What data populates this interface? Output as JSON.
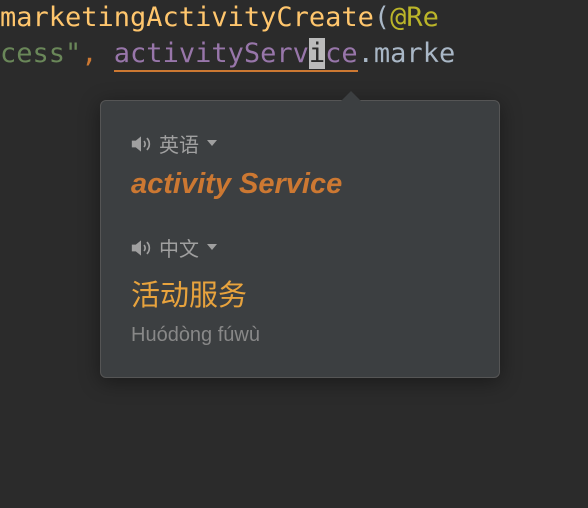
{
  "code": {
    "line1_method": "marketingActivityCreate",
    "line1_paren": "(",
    "line1_annotation": "@Re",
    "line2_string_tail": "cess\"",
    "line2_comma": ", ",
    "line2_ident_pre": "activityServ",
    "line2_ident_cursor": "i",
    "line2_ident_post": "ce",
    "line2_dot": ".",
    "line2_call": "marke"
  },
  "tooltip": {
    "lang_en_label": "英语",
    "translation_en": "activity Service",
    "lang_cn_label": "中文",
    "translation_cn": "活动服务",
    "romanization": "Huódòng fúwù"
  }
}
